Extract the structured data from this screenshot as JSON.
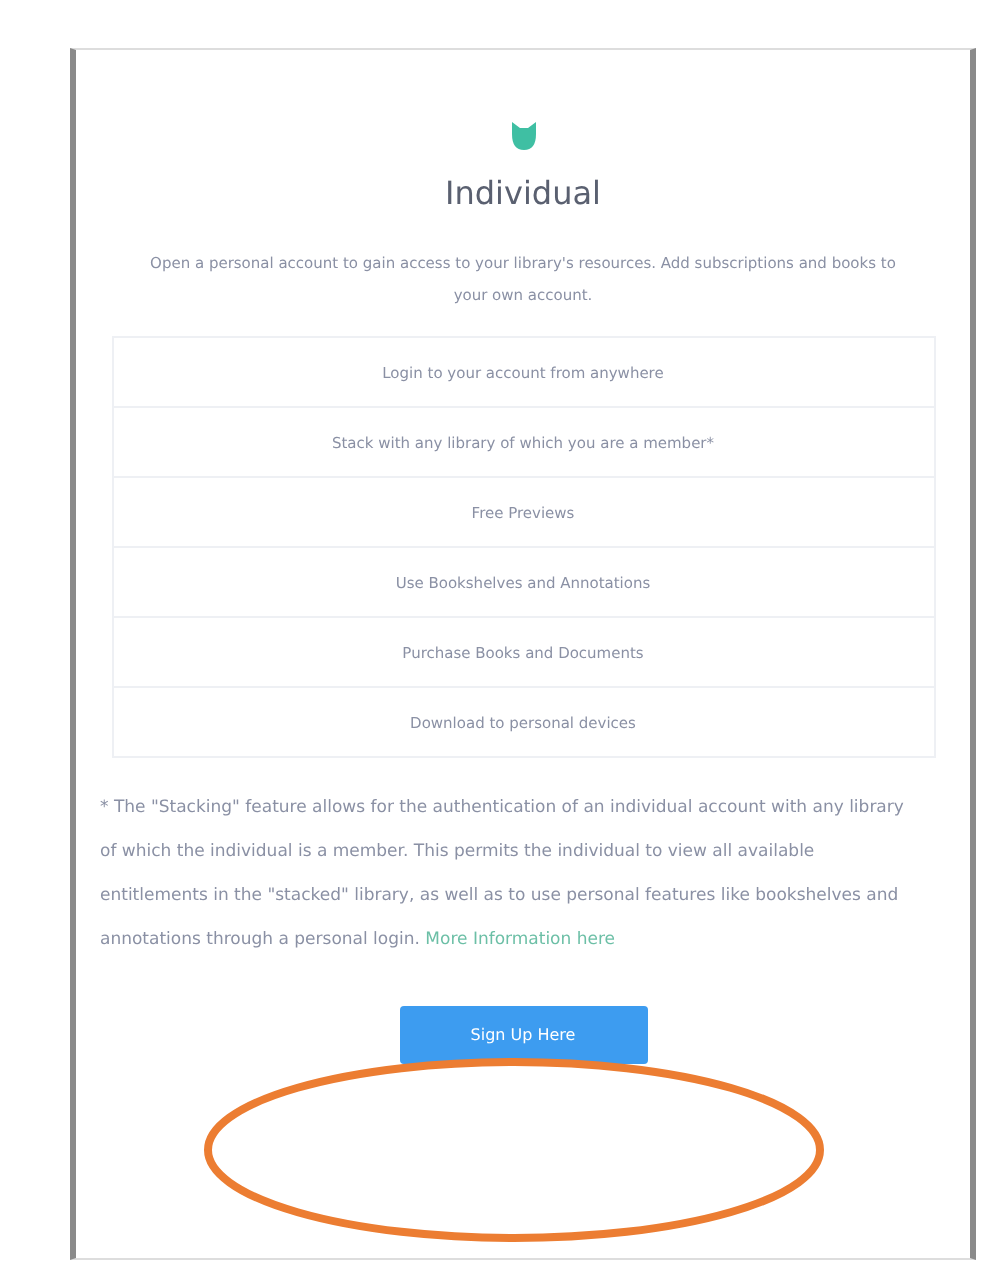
{
  "card": {
    "title": "Individual",
    "description": "Open a personal account to gain access to your library's resources. Add subscriptions and books to your own account.",
    "features": [
      "Login to your account from anywhere",
      "Stack with any library of which you are a member*",
      "Free Previews",
      "Use Bookshelves and Annotations",
      "Purchase Books and Documents",
      "Download to personal devices"
    ],
    "footnote": "* The \"Stacking\" feature allows for the authentication of an individual account with any library of which the individual is a member. This permits the individual to view all available entitlements in the \"stacked\" library, as well as to use personal features like bookshelves and annotations through a personal login.",
    "link": "More Information here",
    "button": "Sign Up Here"
  }
}
